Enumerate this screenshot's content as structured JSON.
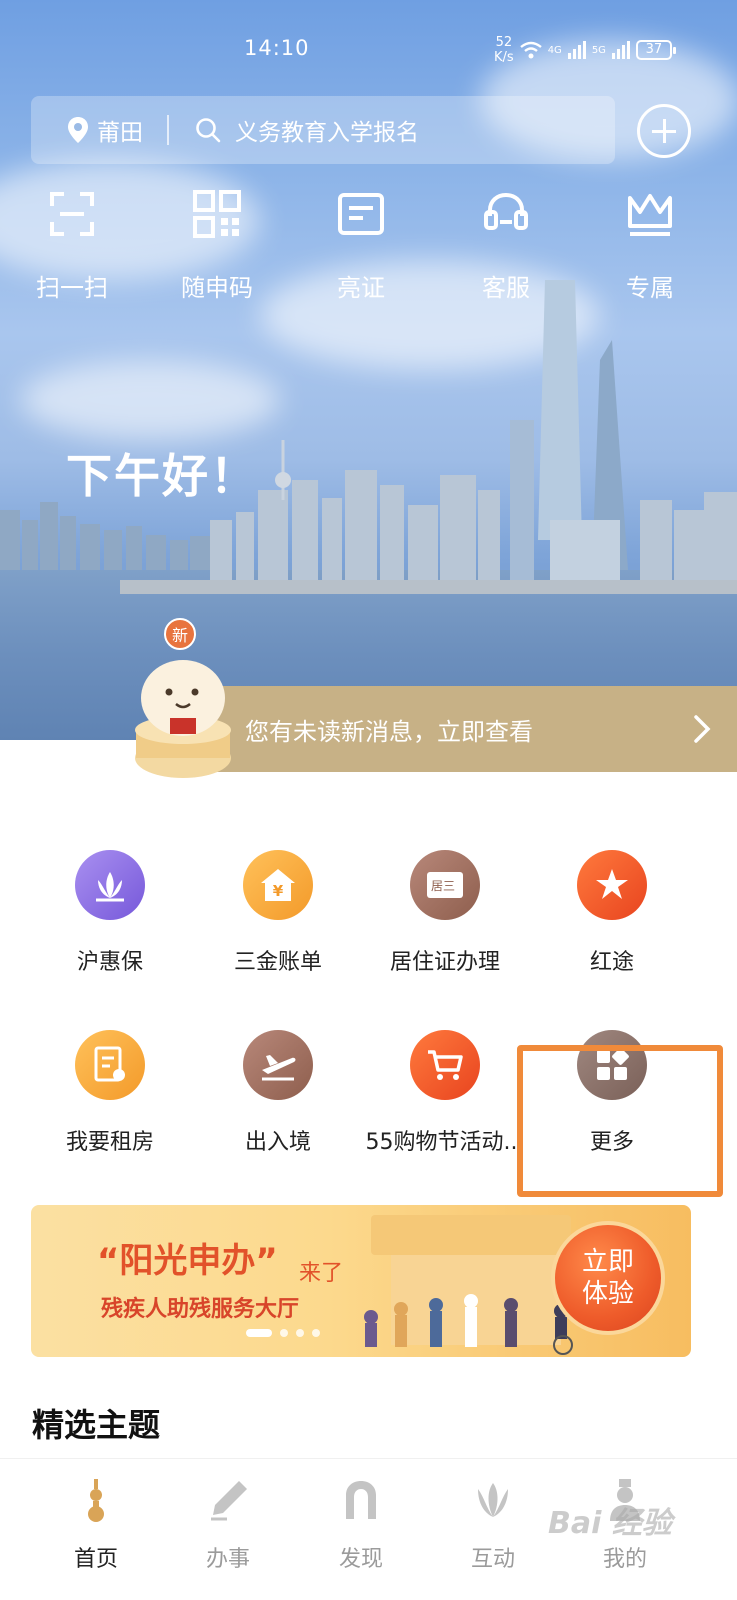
{
  "status_bar": {
    "time": "14:10",
    "net_speed_value": "52",
    "net_speed_unit": "K/s",
    "signal_1": "4G",
    "signal_2": "5G",
    "battery": "37"
  },
  "search": {
    "location": "莆田",
    "placeholder": "义务教育入学报名"
  },
  "quick_actions": [
    {
      "label": "扫一扫",
      "icon": "scan-icon"
    },
    {
      "label": "随申码",
      "icon": "qr-code-icon"
    },
    {
      "label": "亮证",
      "icon": "id-card-icon"
    },
    {
      "label": "客服",
      "icon": "headset-icon"
    },
    {
      "label": "专属",
      "icon": "crown-icon"
    }
  ],
  "greeting": "下午好！",
  "notice": {
    "badge": "新",
    "text": "您有未读新消息，立即查看"
  },
  "services": [
    {
      "label": "沪惠保",
      "icon": "lotus-icon",
      "color": "#8d6ee6"
    },
    {
      "label": "三金账单",
      "icon": "yuan-house-icon",
      "color": "#f3a63b"
    },
    {
      "label": "居住证办理",
      "icon": "residence-card-icon",
      "color": "#9a6b55"
    },
    {
      "label": "红途",
      "icon": "star-icon",
      "color": "#ee5a2a"
    },
    {
      "label": "我要租房",
      "icon": "rent-document-icon",
      "color": "#f3a63b"
    },
    {
      "label": "出入境",
      "icon": "plane-icon",
      "color": "#9a6b55"
    },
    {
      "label": "55购物节活动...",
      "icon": "cart-icon",
      "color": "#ee5a2a"
    },
    {
      "label": "更多",
      "icon": "grid-more-icon",
      "color": "#8a7068"
    }
  ],
  "banner": {
    "title": "“阳光申办”",
    "title_suffix": "来了",
    "subtitle": "残疾人助残服务大厅",
    "button_line1": "立即",
    "button_line2": "体验"
  },
  "section": {
    "title": "精选主题"
  },
  "bottom_nav": [
    {
      "label": "首页",
      "icon": "home-tower-icon",
      "active": true
    },
    {
      "label": "办事",
      "icon": "pen-icon",
      "active": false
    },
    {
      "label": "发现",
      "icon": "discover-arch-icon",
      "active": false
    },
    {
      "label": "互动",
      "icon": "magnolia-icon",
      "active": false
    },
    {
      "label": "我的",
      "icon": "profile-icon",
      "active": false
    }
  ],
  "watermark": "Bai 经验"
}
